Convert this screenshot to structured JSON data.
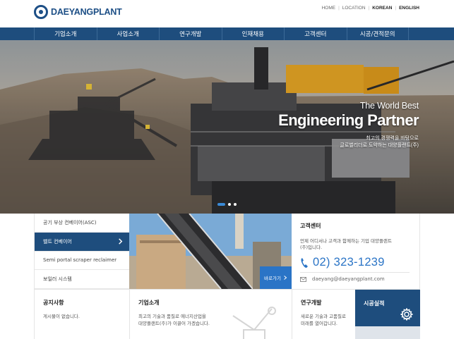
{
  "header": {
    "logo_text": "DAEYANGPLANT",
    "util_links": [
      "HOME",
      "LOCATION",
      "KOREAN",
      "ENGLISH"
    ]
  },
  "nav": {
    "items": [
      "기업소개",
      "사업소개",
      "연구개발",
      "인재채용",
      "고객센터",
      "시공/견적문의"
    ]
  },
  "hero": {
    "line1": "The World Best",
    "line2": "Engineering Partner",
    "line3": "최고의 경쟁력을 바탕으로",
    "line4": "글로벌리더로 도약하는 대양플랜트(주)",
    "slide_count": 3,
    "active_slide": 1
  },
  "products": {
    "items": [
      "공기 부상 컨베이어(ASC)",
      "벨트 컨베이어",
      "Semi portal scraper reclaimer",
      "보일러 시스템"
    ],
    "active_index": 1,
    "more_label": "바로가기"
  },
  "contact": {
    "title": "고객센터",
    "desc": "언제 어디서나 고객과 함께하는 기업 대양플랜트(주)입니다.",
    "phone": "02) 323-1239",
    "email": "daeyang@daeyangplant.com"
  },
  "cards": {
    "notice_title": "공지사항",
    "notice_desc": "게시물이 없습니다.",
    "company_title": "기업소개",
    "company_desc1": "최고의 기술과 품질로 에너지산업을",
    "company_desc2": "대양플랜트(주)가 이끌어 가겠습니다.",
    "rnd_title": "연구개발",
    "rnd_desc1": "새로운 기술과 고품질로",
    "rnd_desc2": "미래를 열어갑니다.",
    "construction_title": "시공실적"
  },
  "colors": {
    "brand": "#1e4d7d",
    "accent": "#2a74c6"
  }
}
